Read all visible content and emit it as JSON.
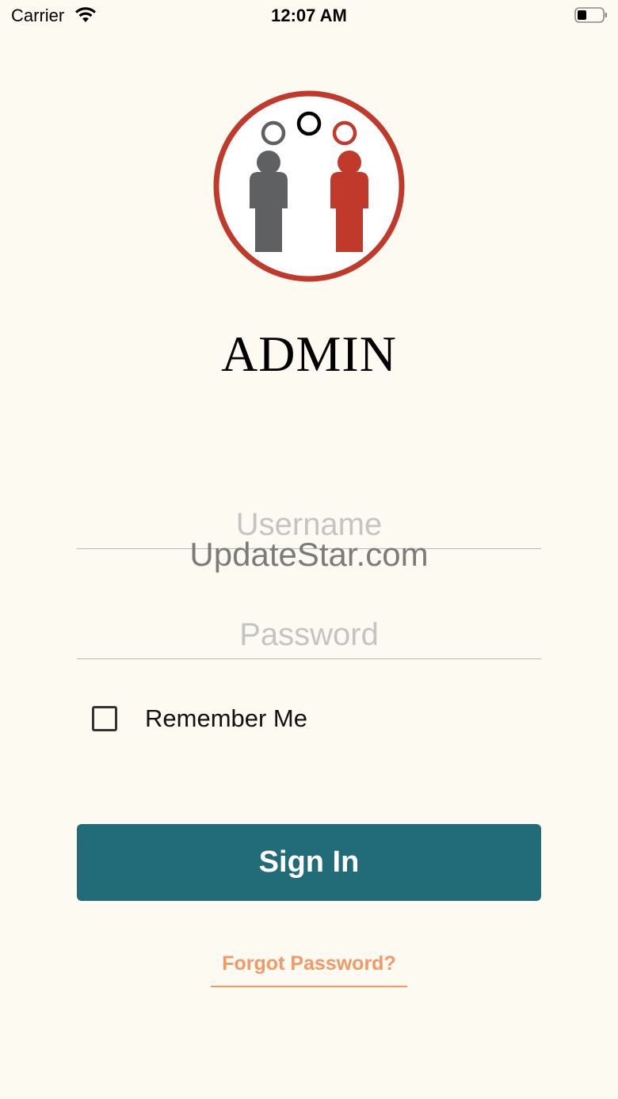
{
  "status_bar": {
    "carrier": "Carrier",
    "time": "12:07 AM",
    "wifi_icon": "wifi-icon",
    "battery_icon": "battery-icon"
  },
  "app": {
    "title": "ADMIN",
    "logo_icon": "admin-people-logo",
    "colors": {
      "logo_red": "#c0392b",
      "logo_gray": "#5f6062",
      "background": "#fdfaf1"
    }
  },
  "form": {
    "username_placeholder": "Username",
    "username_value": "",
    "password_placeholder": "Password",
    "password_value": "",
    "remember_label": "Remember Me",
    "remember_checked": false
  },
  "watermark": "UpdateStar.com",
  "actions": {
    "sign_in_label": "Sign In",
    "sign_in_color": "#226b78",
    "forgot_label": "Forgot Password?",
    "forgot_color": "#f29a67"
  }
}
